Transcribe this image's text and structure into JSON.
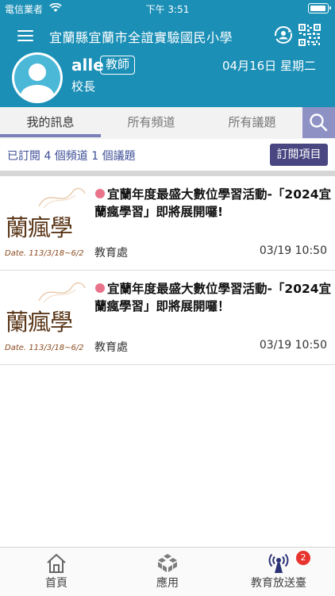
{
  "status_bar": {
    "carrier": "電信業者",
    "time": "下午 3:51"
  },
  "header": {
    "school_name": "宜蘭縣宜蘭市全誼實驗國民小學",
    "user_name": "alle",
    "user_role": "教師",
    "user_title": "校長",
    "date": "04月16日 星期二"
  },
  "tabs": [
    {
      "label": "我的訊息",
      "active": true
    },
    {
      "label": "所有頻道",
      "active": false
    },
    {
      "label": "所有議題",
      "active": false
    }
  ],
  "subscription": {
    "summary": "已訂閱 4 個頻道 1 個議題",
    "button_label": "訂閱項目"
  },
  "messages": [
    {
      "thumb_text": "蘭瘋學",
      "thumb_date": "Date. 113/3/18~6/2",
      "title": "宜蘭年度最盛大數位學習活動-「2024宜蘭瘋學習」即將展開囉!",
      "source": "教育處",
      "timestamp": "03/19 10:50"
    },
    {
      "thumb_text": "蘭瘋學",
      "thumb_date": "Date. 113/3/18~6/2",
      "title": "宜蘭年度最盛大數位學習活動-「2024宜蘭瘋學習」即將展開囉！",
      "source": "教育處",
      "timestamp": "03/19 10:50"
    }
  ],
  "bottom_nav": [
    {
      "label": "首頁",
      "icon": "home-icon"
    },
    {
      "label": "應用",
      "icon": "apps-icon"
    },
    {
      "label": "教育放送臺",
      "icon": "broadcast-icon",
      "badge": "2"
    }
  ],
  "colors": {
    "header": "#1b8fb6",
    "tab_accent": "#7b7fb8",
    "button": "#4a4682",
    "unread_dot": "#e9738a",
    "badge": "#e8332e"
  }
}
